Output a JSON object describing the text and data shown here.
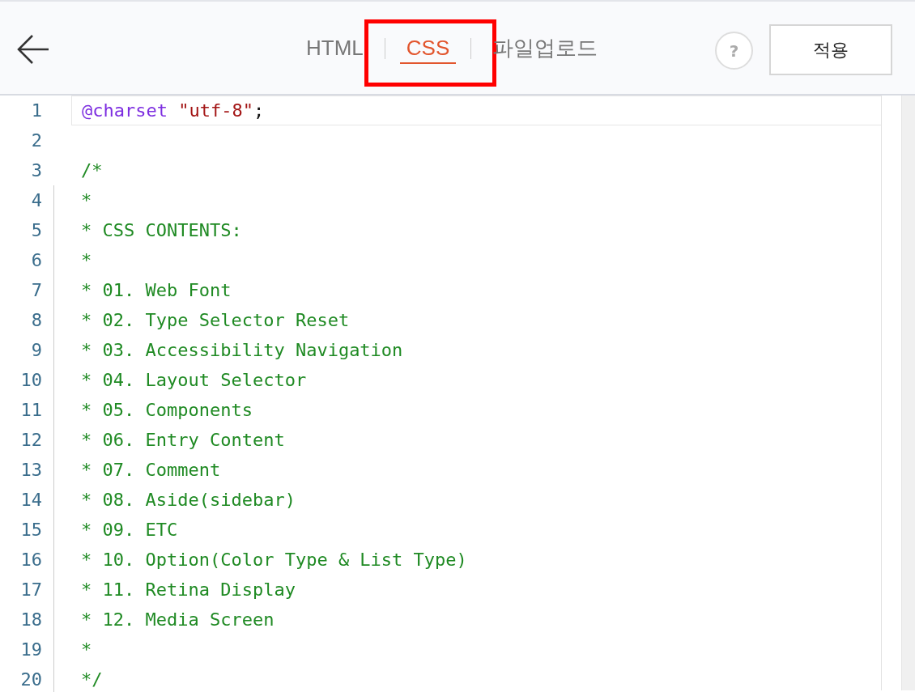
{
  "tabs": [
    {
      "label": "HTML",
      "selected": false,
      "highlighted": false
    },
    {
      "label": "CSS",
      "selected": true,
      "highlighted": true
    },
    {
      "label": "파일업로드",
      "selected": false,
      "highlighted": false
    }
  ],
  "help_button": {
    "label": "?"
  },
  "apply_button": {
    "label": "적용"
  },
  "editor": {
    "lines": [
      {
        "number": "1",
        "active": true,
        "indent": false,
        "segments": [
          {
            "kind": "at-rule",
            "text": "@charset "
          },
          {
            "kind": "string",
            "text": "\"utf-8\""
          },
          {
            "kind": "plain",
            "text": ";"
          }
        ]
      },
      {
        "number": "2",
        "active": false,
        "indent": false
      },
      {
        "number": "3",
        "active": false,
        "indent": false,
        "segments": [
          {
            "kind": "comment",
            "text": "/*"
          }
        ]
      },
      {
        "number": "4",
        "active": false,
        "indent": true,
        "segments": [
          {
            "kind": "comment",
            "text": "*"
          }
        ]
      },
      {
        "number": "5",
        "active": false,
        "indent": true,
        "segments": [
          {
            "kind": "comment",
            "text": "* CSS CONTENTS:"
          }
        ]
      },
      {
        "number": "6",
        "active": false,
        "indent": true,
        "segments": [
          {
            "kind": "comment",
            "text": "*"
          }
        ]
      },
      {
        "number": "7",
        "active": false,
        "indent": true,
        "segments": [
          {
            "kind": "comment",
            "text": "* 01. Web Font"
          }
        ]
      },
      {
        "number": "8",
        "active": false,
        "indent": true,
        "segments": [
          {
            "kind": "comment",
            "text": "* 02. Type Selector Reset"
          }
        ]
      },
      {
        "number": "9",
        "active": false,
        "indent": true,
        "segments": [
          {
            "kind": "comment",
            "text": "* 03. Accessibility Navigation"
          }
        ]
      },
      {
        "number": "10",
        "active": false,
        "indent": true,
        "segments": [
          {
            "kind": "comment",
            "text": "* 04. Layout Selector"
          }
        ]
      },
      {
        "number": "11",
        "active": false,
        "indent": true,
        "segments": [
          {
            "kind": "comment",
            "text": "* 05. Components"
          }
        ]
      },
      {
        "number": "12",
        "active": false,
        "indent": true,
        "segments": [
          {
            "kind": "comment",
            "text": "* 06. Entry Content"
          }
        ]
      },
      {
        "number": "13",
        "active": false,
        "indent": true,
        "segments": [
          {
            "kind": "comment",
            "text": "* 07. Comment"
          }
        ]
      },
      {
        "number": "14",
        "active": false,
        "indent": true,
        "segments": [
          {
            "kind": "comment",
            "text": "* 08. Aside(sidebar)"
          }
        ]
      },
      {
        "number": "15",
        "active": false,
        "indent": true,
        "segments": [
          {
            "kind": "comment",
            "text": "* 09. ETC"
          }
        ]
      },
      {
        "number": "16",
        "active": false,
        "indent": true,
        "segments": [
          {
            "kind": "comment",
            "text": "* 10. Option(Color Type & List Type)"
          }
        ]
      },
      {
        "number": "17",
        "active": false,
        "indent": true,
        "segments": [
          {
            "kind": "comment",
            "text": "* 11. Retina Display"
          }
        ]
      },
      {
        "number": "18",
        "active": false,
        "indent": true,
        "segments": [
          {
            "kind": "comment",
            "text": "* 12. Media Screen"
          }
        ]
      },
      {
        "number": "19",
        "active": false,
        "indent": true,
        "segments": [
          {
            "kind": "comment",
            "text": "*"
          }
        ]
      },
      {
        "number": "20",
        "active": false,
        "indent": true,
        "segments": [
          {
            "kind": "comment",
            "text": "*/"
          }
        ]
      }
    ]
  }
}
